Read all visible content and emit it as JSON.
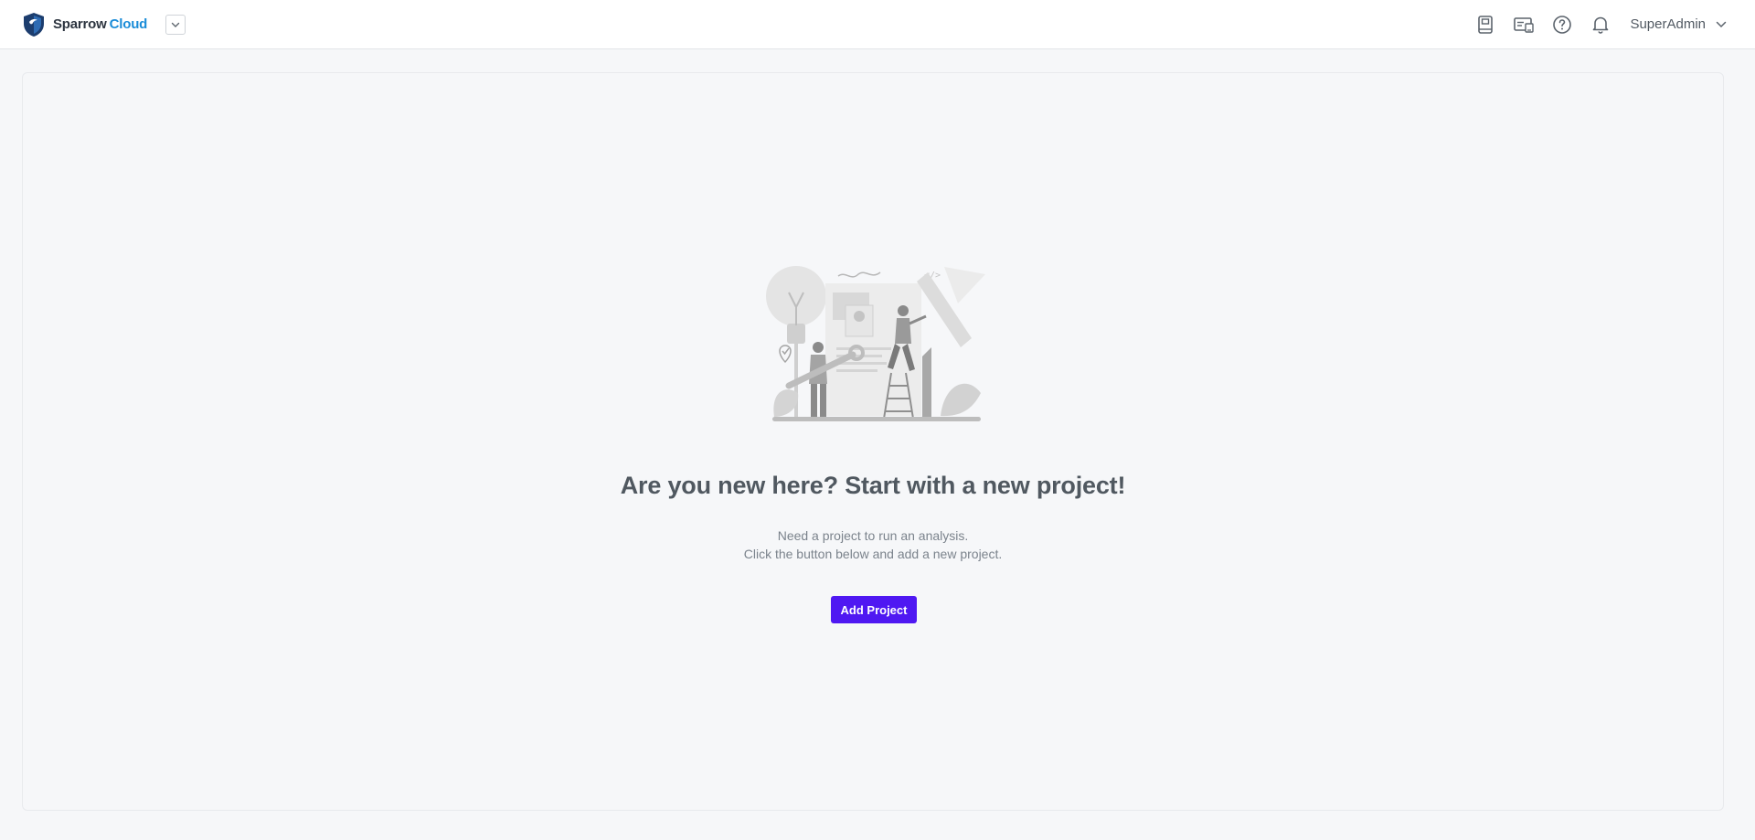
{
  "header": {
    "brand": {
      "word1": "Sparrow",
      "word2": "Cloud"
    },
    "icons": [
      "book-icon",
      "ticket-icon",
      "help-icon",
      "bell-icon"
    ],
    "user": {
      "name": "SuperAdmin"
    }
  },
  "empty_state": {
    "illustration": "people-building-project-illustration",
    "title": "Are you new here? Start with a new project!",
    "line1": "Need a project to run an analysis.",
    "line2": "Click the button below and add a new project.",
    "button_label": "Add Project"
  },
  "colors": {
    "brand_accent": "#1a8cd8",
    "primary_button": "#4f18f2",
    "background": "#f6f7f9"
  }
}
